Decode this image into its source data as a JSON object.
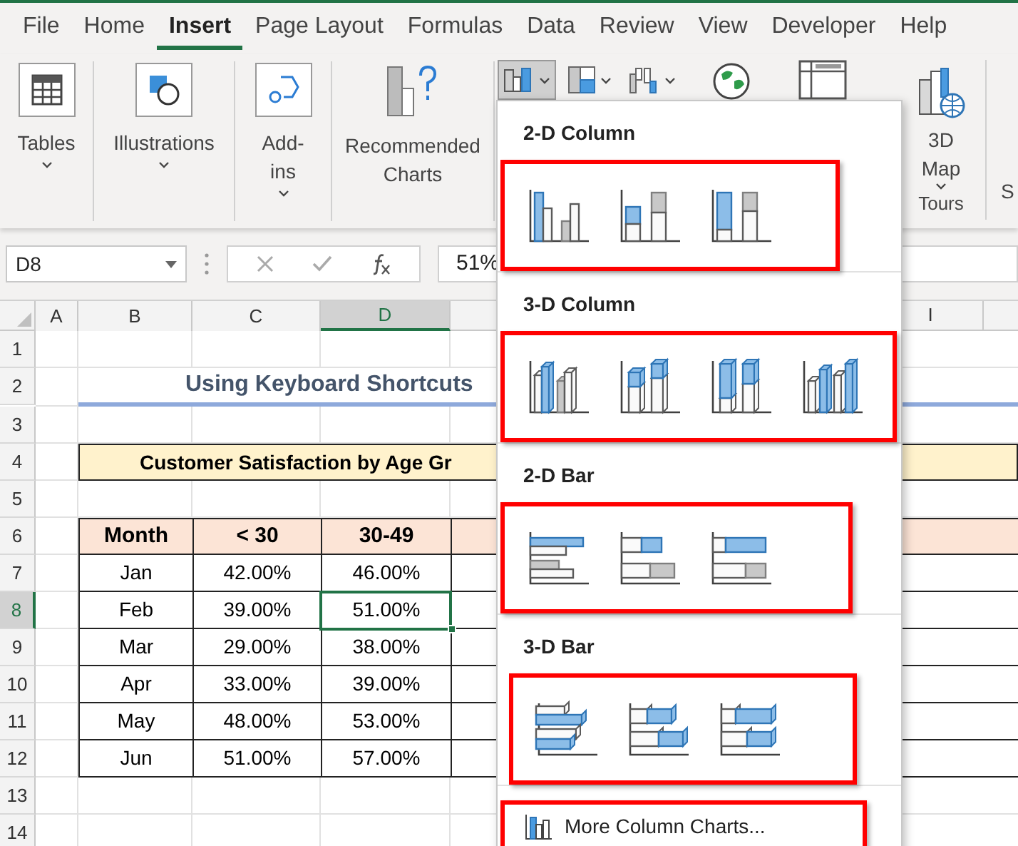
{
  "tabs": [
    {
      "label": "File",
      "selected": false
    },
    {
      "label": "Home",
      "selected": false
    },
    {
      "label": "Insert",
      "selected": true
    },
    {
      "label": "Page Layout",
      "selected": false
    },
    {
      "label": "Formulas",
      "selected": false
    },
    {
      "label": "Data",
      "selected": false
    },
    {
      "label": "Review",
      "selected": false
    },
    {
      "label": "View",
      "selected": false
    },
    {
      "label": "Developer",
      "selected": false
    },
    {
      "label": "Help",
      "selected": false
    }
  ],
  "ribbon": {
    "groups": [
      {
        "kind": "tables",
        "label": "Tables"
      },
      {
        "kind": "illustrations",
        "label": "Illustrations"
      },
      {
        "kind": "addins",
        "label": "Add-ins"
      },
      {
        "kind": "recommended",
        "label": "Recommended Charts"
      }
    ],
    "chart_buttons": [
      {
        "kind": "column",
        "selected": true
      },
      {
        "kind": "hierarchy",
        "selected": false
      },
      {
        "kind": "waterfall",
        "selected": false
      },
      {
        "kind": "map",
        "selected": false
      },
      {
        "kind": "pivot",
        "selected": false
      }
    ],
    "map_button": {
      "label": "3D Map"
    },
    "tours_label": "Tours",
    "next_group_label": "S"
  },
  "formula_bar": {
    "name_box": "D8",
    "formula": "51%"
  },
  "columns": [
    {
      "label": "A",
      "selected": false
    },
    {
      "label": "B",
      "selected": false
    },
    {
      "label": "C",
      "selected": false
    },
    {
      "label": "D",
      "selected": true
    },
    {
      "label": "I",
      "selected": false
    }
  ],
  "row_numbers": [
    {
      "label": "1",
      "selected": false
    },
    {
      "label": "2",
      "selected": false
    },
    {
      "label": "3",
      "selected": false
    },
    {
      "label": "4",
      "selected": false
    },
    {
      "label": "5",
      "selected": false
    },
    {
      "label": "6",
      "selected": false
    },
    {
      "label": "7",
      "selected": false
    },
    {
      "label": "8",
      "selected": true
    },
    {
      "label": "9",
      "selected": false
    },
    {
      "label": "10",
      "selected": false
    },
    {
      "label": "11",
      "selected": false
    },
    {
      "label": "12",
      "selected": false
    },
    {
      "label": "13",
      "selected": false
    },
    {
      "label": "14",
      "selected": false
    }
  ],
  "sheet": {
    "title": "Using Keyboard Shortcuts",
    "subtitle": "Customer Satisfaction by Age Gr",
    "table": {
      "columns": [
        "Month",
        "< 30",
        "30-49"
      ],
      "rows": [
        {
          "cells": [
            {
              "text": "Jan",
              "selected": false
            },
            {
              "text": "42.00%",
              "selected": false
            },
            {
              "text": "46.00%",
              "selected": false
            }
          ]
        },
        {
          "cells": [
            {
              "text": "Feb",
              "selected": false
            },
            {
              "text": "39.00%",
              "selected": false
            },
            {
              "text": "51.00%",
              "selected": true
            }
          ]
        },
        {
          "cells": [
            {
              "text": "Mar",
              "selected": false
            },
            {
              "text": "29.00%",
              "selected": false
            },
            {
              "text": "38.00%",
              "selected": false
            }
          ]
        },
        {
          "cells": [
            {
              "text": "Apr",
              "selected": false
            },
            {
              "text": "33.00%",
              "selected": false
            },
            {
              "text": "39.00%",
              "selected": false
            }
          ]
        },
        {
          "cells": [
            {
              "text": "May",
              "selected": false
            },
            {
              "text": "48.00%",
              "selected": false
            },
            {
              "text": "53.00%",
              "selected": false
            }
          ]
        },
        {
          "cells": [
            {
              "text": "Jun",
              "selected": false
            },
            {
              "text": "51.00%",
              "selected": false
            },
            {
              "text": "57.00%",
              "selected": false
            }
          ]
        }
      ]
    }
  },
  "chart_menu": {
    "sections": [
      {
        "title": "2-D Column",
        "highlighted": true,
        "options": [
          {
            "kind": "col-clustered"
          },
          {
            "kind": "col-stacked"
          },
          {
            "kind": "col-percent"
          }
        ]
      },
      {
        "title": "3-D Column",
        "highlighted": true,
        "options": [
          {
            "kind": "col3d-clustered"
          },
          {
            "kind": "col3d-stacked"
          },
          {
            "kind": "col3d-percent"
          },
          {
            "kind": "col3d"
          }
        ]
      },
      {
        "title": "2-D Bar",
        "highlighted": true,
        "options": [
          {
            "kind": "bar-clustered"
          },
          {
            "kind": "bar-stacked"
          },
          {
            "kind": "bar-percent"
          }
        ]
      },
      {
        "title": "3-D Bar",
        "highlighted": true,
        "options": [
          {
            "kind": "bar3d-clustered"
          },
          {
            "kind": "bar3d-stacked"
          },
          {
            "kind": "bar3d-percent"
          }
        ]
      }
    ],
    "more": {
      "label": "More Column Charts...",
      "highlighted": true
    }
  }
}
